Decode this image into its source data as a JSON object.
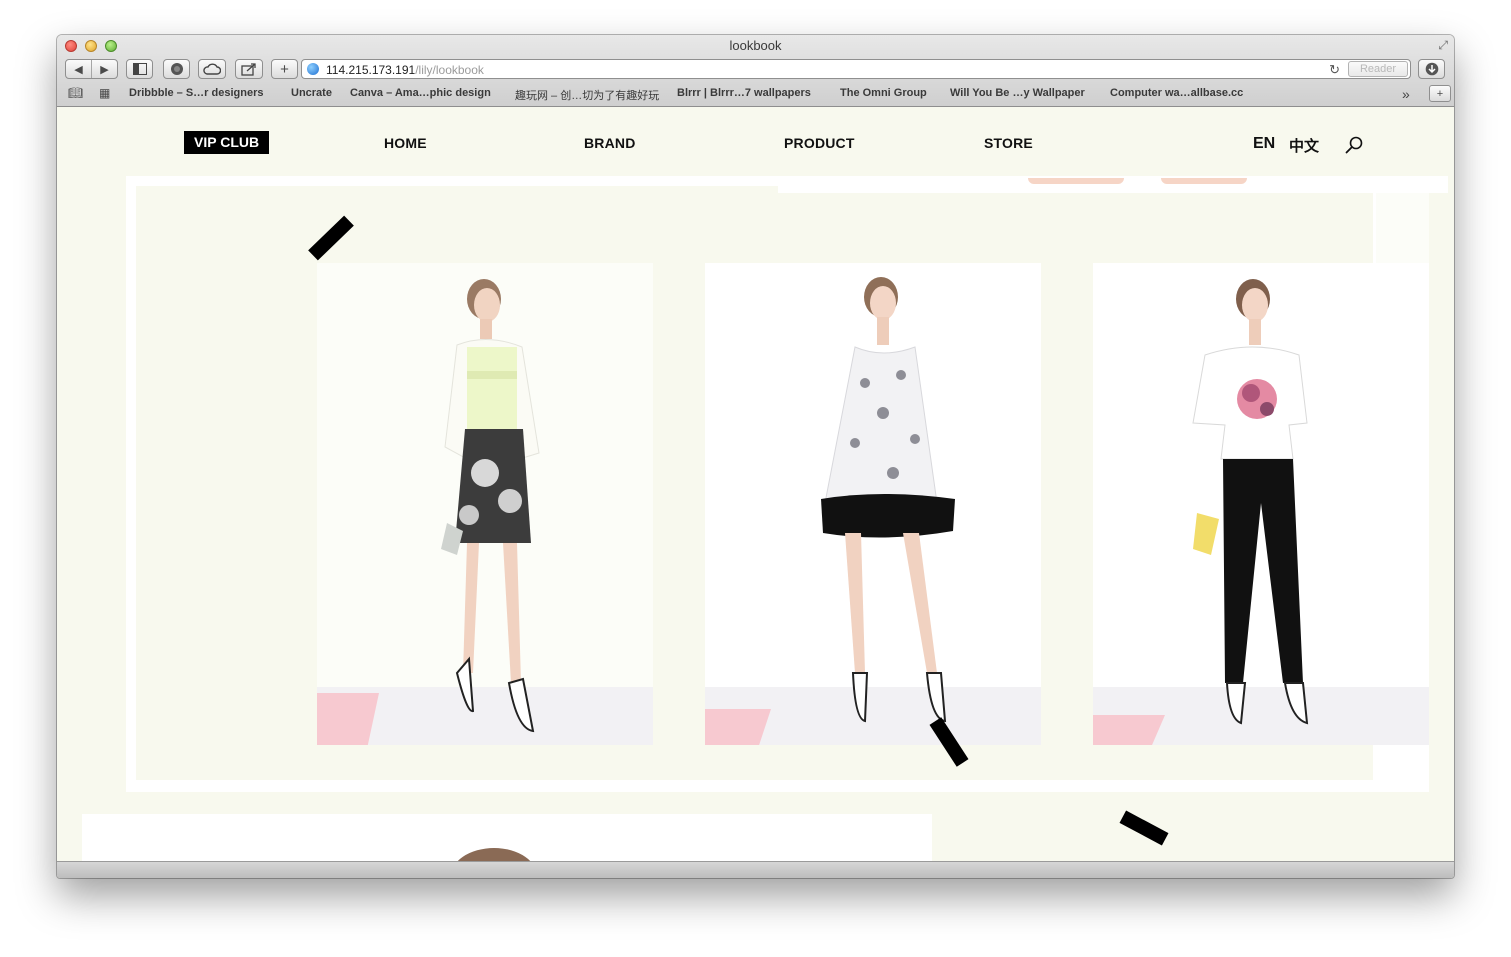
{
  "window": {
    "title": "lookbook"
  },
  "toolbar": {
    "url_host": "114.215.173.191",
    "url_path": "/lily/lookbook",
    "reader_label": "Reader",
    "icons": [
      "back-icon",
      "forward-icon",
      "sidebar-icon",
      "top-sites-icon",
      "cloud-icon",
      "share-icon",
      "add-icon",
      "reload-icon",
      "download-icon"
    ]
  },
  "bookmarks": [
    "Dribbble – S…r designers",
    "Uncrate",
    "Canva – Ama…phic design",
    "趣玩网 – 创…切为了有趣好玩",
    "Blrrr | Blrrr…7 wallpapers",
    "The Omni Group",
    "Will You Be …y Wallpaper",
    "Computer wa…allbase.cc"
  ],
  "nav": {
    "vip": "VIP CLUB",
    "items": [
      "HOME",
      "BRAND",
      "PRODUCT",
      "STORE"
    ],
    "lang_en": "EN",
    "lang_zh": "中文"
  },
  "colors": {
    "page_bg": "#f8f9ee",
    "accent_pink": "#f7c9d0",
    "nav_active_bg": "#000000"
  },
  "lookbook": {
    "looks": [
      {
        "outfit": "sheer white cardigan, lime top, black floral skirt"
      },
      {
        "outfit": "grey floral sleeveless dress with black ruffle hem"
      },
      {
        "outfit": "white tee with rose print, black trousers, yellow clutch"
      }
    ]
  }
}
